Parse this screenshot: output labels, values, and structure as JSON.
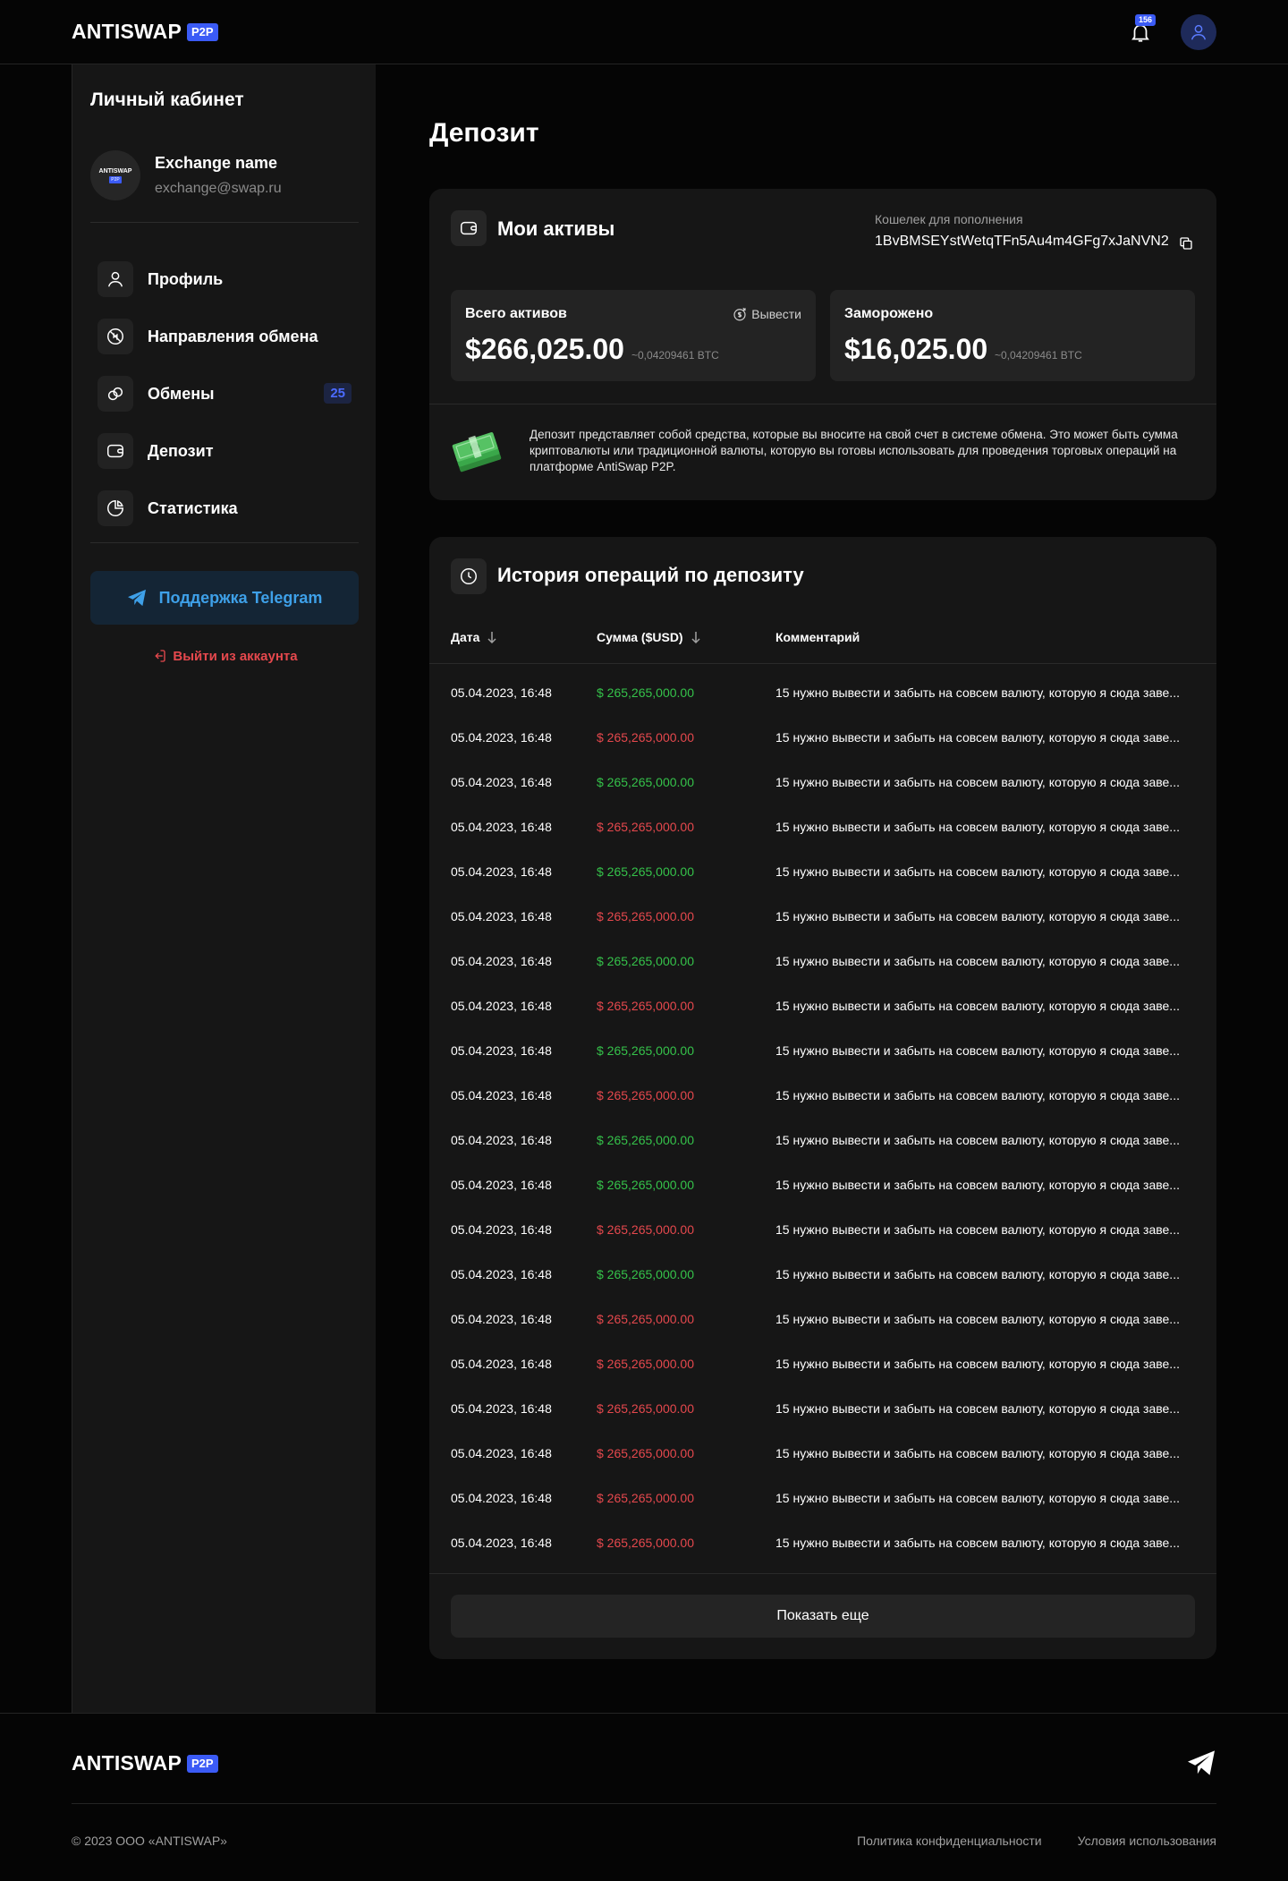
{
  "header": {
    "logo": "ANTISWAP",
    "logo_badge": "P2P",
    "notifications_count": "156",
    "icons": [
      "bell-icon",
      "user-icon"
    ]
  },
  "sidebar": {
    "title": "Личный кабинет",
    "exchange": {
      "name": "Exchange name",
      "email": "exchange@swap.ru",
      "logo_text": "ANTISWAP",
      "logo_badge": "P2P"
    },
    "items": [
      {
        "label": "Профиль",
        "icon": "user-icon"
      },
      {
        "label": "Направления обмена",
        "icon": "exchange-directions-icon"
      },
      {
        "label": "Обмены",
        "icon": "links-icon",
        "badge": "25"
      },
      {
        "label": "Депозит",
        "icon": "wallet-icon"
      },
      {
        "label": "Статистика",
        "icon": "pie-chart-icon"
      }
    ],
    "telegram_button": "Поддержка Telegram",
    "logout": "Выйти из аккаунта"
  },
  "main": {
    "title": "Депозит",
    "assets": {
      "title": "Мои активы",
      "wallet_label": "Кошелек для пополнения",
      "wallet_address": "1BvBMSEYstWetqTFn5Au4m4GFg7xJaNVN2",
      "total_label": "Всего активов",
      "total_value": "$266,025.00",
      "total_btc": "~0,04209461 BTC",
      "withdraw": "Вывести",
      "frozen_label": "Заморожено",
      "frozen_value": "$16,025.00",
      "frozen_btc": "~0,04209461 BTC",
      "info": "Депозит представляет собой средства, которые вы вносите на свой счет в системе обмена. Это может быть сумма криптовалюты или традиционной валюты, которую вы готовы использовать для проведения торговых операций на платформе AntiSwap P2P."
    },
    "history": {
      "title": "История операций по депозиту",
      "columns": [
        "Дата",
        "Сумма ($USD)",
        "Комментарий"
      ],
      "rows": [
        {
          "date": "05.04.2023, 16:48",
          "sum": "$ 265,265,000.00",
          "type": "pos",
          "comment": "15 нужно вывести и забыть на совсем валюту, которую я сюда заве..."
        },
        {
          "date": "05.04.2023, 16:48",
          "sum": "$ 265,265,000.00",
          "type": "neg",
          "comment": "15 нужно вывести и забыть на совсем валюту, которую я сюда заве..."
        },
        {
          "date": "05.04.2023, 16:48",
          "sum": "$ 265,265,000.00",
          "type": "pos",
          "comment": "15 нужно вывести и забыть на совсем валюту, которую я сюда заве..."
        },
        {
          "date": "05.04.2023, 16:48",
          "sum": "$ 265,265,000.00",
          "type": "neg",
          "comment": "15 нужно вывести и забыть на совсем валюту, которую я сюда заве..."
        },
        {
          "date": "05.04.2023, 16:48",
          "sum": "$ 265,265,000.00",
          "type": "pos",
          "comment": "15 нужно вывести и забыть на совсем валюту, которую я сюда заве..."
        },
        {
          "date": "05.04.2023, 16:48",
          "sum": "$ 265,265,000.00",
          "type": "neg",
          "comment": "15 нужно вывести и забыть на совсем валюту, которую я сюда заве..."
        },
        {
          "date": "05.04.2023, 16:48",
          "sum": "$ 265,265,000.00",
          "type": "pos",
          "comment": "15 нужно вывести и забыть на совсем валюту, которую я сюда заве..."
        },
        {
          "date": "05.04.2023, 16:48",
          "sum": "$ 265,265,000.00",
          "type": "neg",
          "comment": "15 нужно вывести и забыть на совсем валюту, которую я сюда заве..."
        },
        {
          "date": "05.04.2023, 16:48",
          "sum": "$ 265,265,000.00",
          "type": "pos",
          "comment": "15 нужно вывести и забыть на совсем валюту, которую я сюда заве..."
        },
        {
          "date": "05.04.2023, 16:48",
          "sum": "$ 265,265,000.00",
          "type": "neg",
          "comment": "15 нужно вывести и забыть на совсем валюту, которую я сюда заве..."
        },
        {
          "date": "05.04.2023, 16:48",
          "sum": "$ 265,265,000.00",
          "type": "pos",
          "comment": "15 нужно вывести и забыть на совсем валюту, которую я сюда заве..."
        },
        {
          "date": "05.04.2023, 16:48",
          "sum": "$ 265,265,000.00",
          "type": "pos",
          "comment": "15 нужно вывести и забыть на совсем валюту, которую я сюда заве..."
        },
        {
          "date": "05.04.2023, 16:48",
          "sum": "$ 265,265,000.00",
          "type": "neg",
          "comment": "15 нужно вывести и забыть на совсем валюту, которую я сюда заве..."
        },
        {
          "date": "05.04.2023, 16:48",
          "sum": "$ 265,265,000.00",
          "type": "pos",
          "comment": "15 нужно вывести и забыть на совсем валюту, которую я сюда заве..."
        },
        {
          "date": "05.04.2023, 16:48",
          "sum": "$ 265,265,000.00",
          "type": "neg",
          "comment": "15 нужно вывести и забыть на совсем валюту, которую я сюда заве..."
        },
        {
          "date": "05.04.2023, 16:48",
          "sum": "$ 265,265,000.00",
          "type": "neg",
          "comment": "15 нужно вывести и забыть на совсем валюту, которую я сюда заве..."
        },
        {
          "date": "05.04.2023, 16:48",
          "sum": "$ 265,265,000.00",
          "type": "neg",
          "comment": "15 нужно вывести и забыть на совсем валюту, которую я сюда заве..."
        },
        {
          "date": "05.04.2023, 16:48",
          "sum": "$ 265,265,000.00",
          "type": "neg",
          "comment": "15 нужно вывести и забыть на совсем валюту, которую я сюда заве..."
        },
        {
          "date": "05.04.2023, 16:48",
          "sum": "$ 265,265,000.00",
          "type": "neg",
          "comment": "15 нужно вывести и забыть на совсем валюту, которую я сюда заве..."
        },
        {
          "date": "05.04.2023, 16:48",
          "sum": "$ 265,265,000.00",
          "type": "neg",
          "comment": "15 нужно вывести и забыть на совсем валюту, которую я сюда заве..."
        }
      ],
      "show_more": "Показать еще"
    }
  },
  "footer": {
    "logo": "ANTISWAP",
    "logo_badge": "P2P",
    "copyright": "© 2023 ООО «ANTISWAP»",
    "privacy": "Политика конфиденциальности",
    "terms": "Условия использования"
  },
  "colors": {
    "accent": "#3b5bf6",
    "positive": "#35c24a",
    "negative": "#e5484d",
    "telegram": "#3ea0e8"
  }
}
